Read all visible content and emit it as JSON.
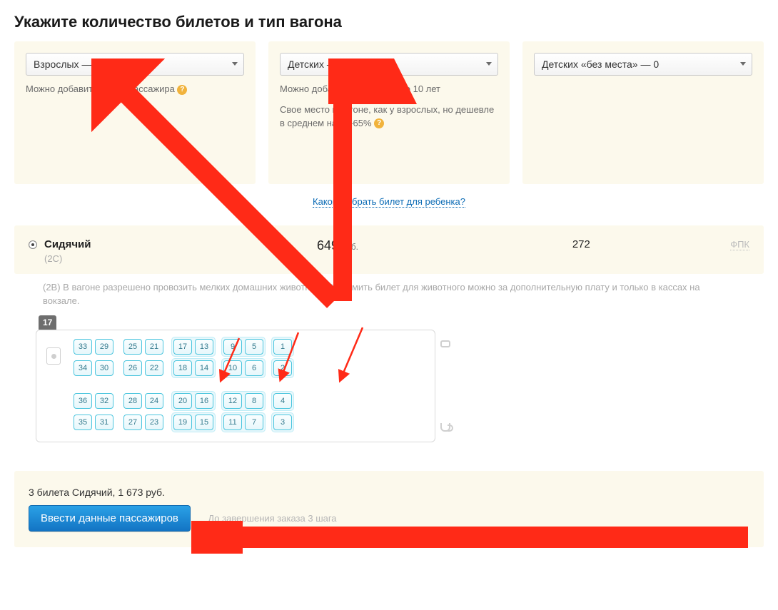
{
  "heading": "Укажите количество билетов и тип вагона",
  "selectors": {
    "adults": {
      "label": "Взрослых — 2",
      "hint": "Можно добавить еще 1 пассажира"
    },
    "children": {
      "label": "Детских — 1",
      "hint1": "Можно добавить 1 ребенка до 10 лет",
      "hint2": "Свое место в вагоне, как у взрослых, но дешевле в среднем на 50-65%"
    },
    "infants": {
      "label": "Детских «без места» — 0"
    }
  },
  "child_link": "Какой выбрать билет для ребенка?",
  "car_type": {
    "name": "Сидячий",
    "sub": "(2С)",
    "price": "649",
    "currency": "руб.",
    "available": "272",
    "carrier": "ФПК"
  },
  "wagon_note": "(2В) В вагоне разрешено провозить мелких домашних животных. Оформить билет для животного можно за дополнительную плату и только в кассах на вокзале.",
  "car_number": "17",
  "seat_rows": {
    "top1": [
      [
        "33",
        "29"
      ],
      [
        "25",
        "21"
      ],
      [
        "17",
        "13"
      ],
      [
        "9",
        "5"
      ],
      [
        "1"
      ]
    ],
    "top2": [
      [
        "34",
        "30"
      ],
      [
        "26",
        "22"
      ],
      [
        "18",
        "14"
      ],
      [
        "10",
        "6"
      ],
      [
        "2"
      ]
    ],
    "bottom1": [
      [
        "36",
        "32"
      ],
      [
        "28",
        "24"
      ],
      [
        "20",
        "16"
      ],
      [
        "12",
        "8"
      ],
      [
        "4"
      ]
    ],
    "bottom2": [
      [
        "35",
        "31"
      ],
      [
        "27",
        "23"
      ],
      [
        "19",
        "15"
      ],
      [
        "11",
        "7"
      ],
      [
        "3"
      ]
    ]
  },
  "highlight_blocks": [
    2,
    3,
    4
  ],
  "summary": {
    "line": "3 билета Сидячий, 1 673 руб.",
    "button": "Ввести данные пассажиров",
    "steps": "До завершения заказа 3 шага"
  }
}
